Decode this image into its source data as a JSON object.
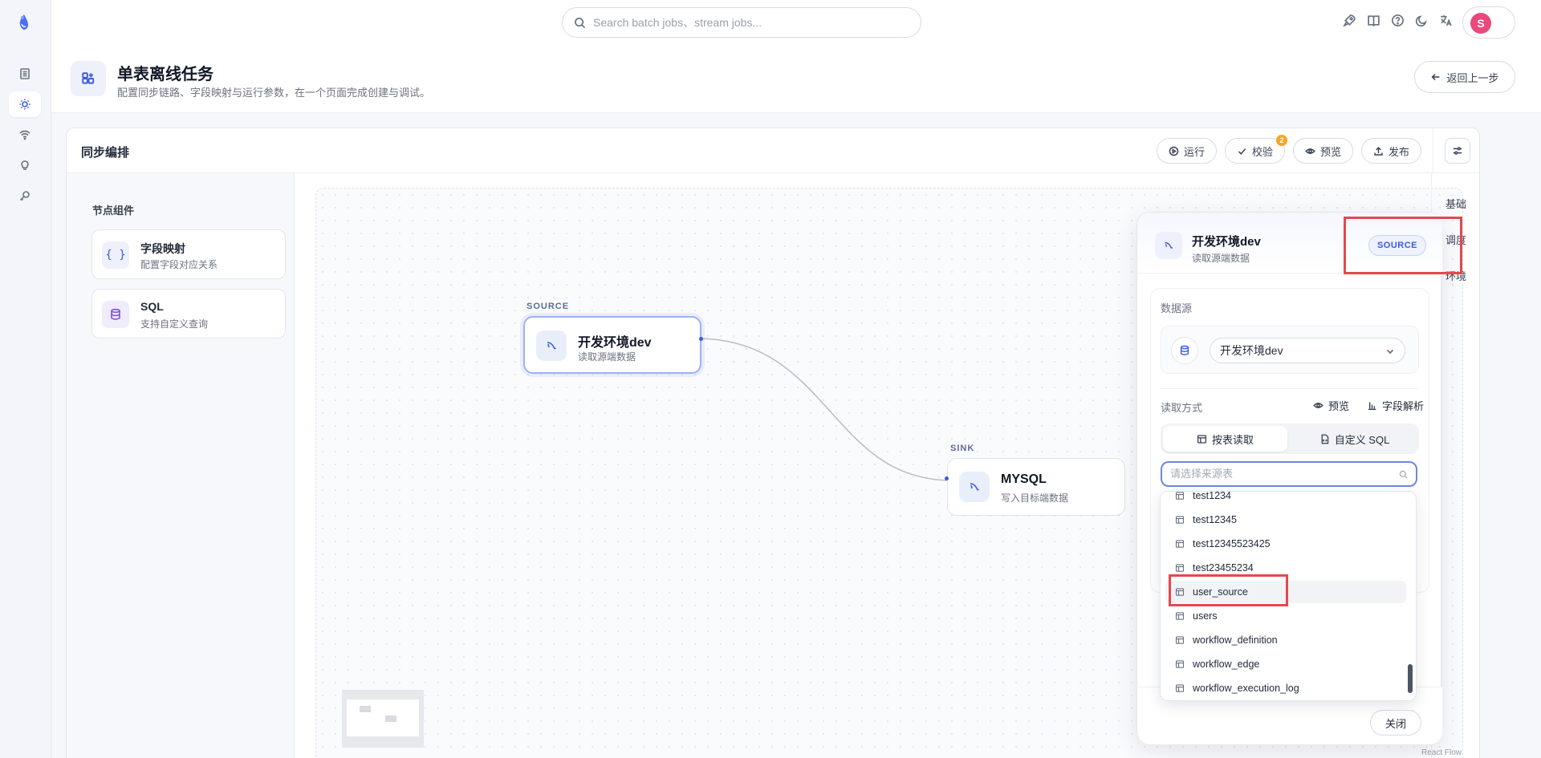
{
  "topbar": {
    "search_placeholder": "Search batch jobs、stream jobs...",
    "user_initial": "S"
  },
  "sidebar": {
    "items": [
      {
        "icon": "document-icon",
        "active": false
      },
      {
        "icon": "sun-icon",
        "active": true
      },
      {
        "icon": "wifi-icon",
        "active": false
      },
      {
        "icon": "lightbulb-icon",
        "active": false
      },
      {
        "icon": "key-search-icon",
        "active": false
      }
    ]
  },
  "page": {
    "title": "单表离线任务",
    "subtitle": "配置同步链路、字段映射与运行参数，在一个页面完成创建与调试。",
    "back_label": "返回上一步"
  },
  "card": {
    "title": "同步编排",
    "actions": {
      "run": "运行",
      "validate": "校验",
      "validate_badge": "2",
      "preview": "预览",
      "publish": "发布"
    }
  },
  "palette": {
    "title": "节点组件",
    "items": [
      {
        "icon": "{ }",
        "name": "字段映射",
        "desc": "配置字段对应关系"
      },
      {
        "icon": "database-icon",
        "name": "SQL",
        "desc": "支持自定义查询"
      }
    ]
  },
  "canvas": {
    "source": {
      "tag": "SOURCE",
      "name": "开发环境dev",
      "desc": "读取源端数据"
    },
    "sink": {
      "tag": "SINK",
      "name": "MYSQL",
      "desc": "写入目标端数据"
    },
    "attribution": "React Flow"
  },
  "right_tabs": [
    "基础",
    "调度",
    "环境"
  ],
  "panel": {
    "title": "开发环境dev",
    "subtitle": "读取源端数据",
    "tag": "SOURCE",
    "datasource_label": "数据源",
    "datasource_value": "开发环境dev",
    "read_mode_label": "读取方式",
    "preview_label": "预览",
    "field_parse_label": "字段解析",
    "mode_table": "按表读取",
    "mode_sql": "自定义 SQL",
    "table_placeholder": "请选择来源表",
    "tables": [
      "test1234",
      "test12345",
      "test12345523425",
      "test23455234",
      "user_source",
      "users",
      "workflow_definition",
      "workflow_edge",
      "workflow_execution_log"
    ],
    "highlighted_table": "user_source",
    "close_label": "关闭"
  },
  "colors": {
    "accent": "#3b5bdb",
    "highlight_box": "#e5484d",
    "badge": "#f5a623",
    "avatar": "#e84a7a"
  }
}
